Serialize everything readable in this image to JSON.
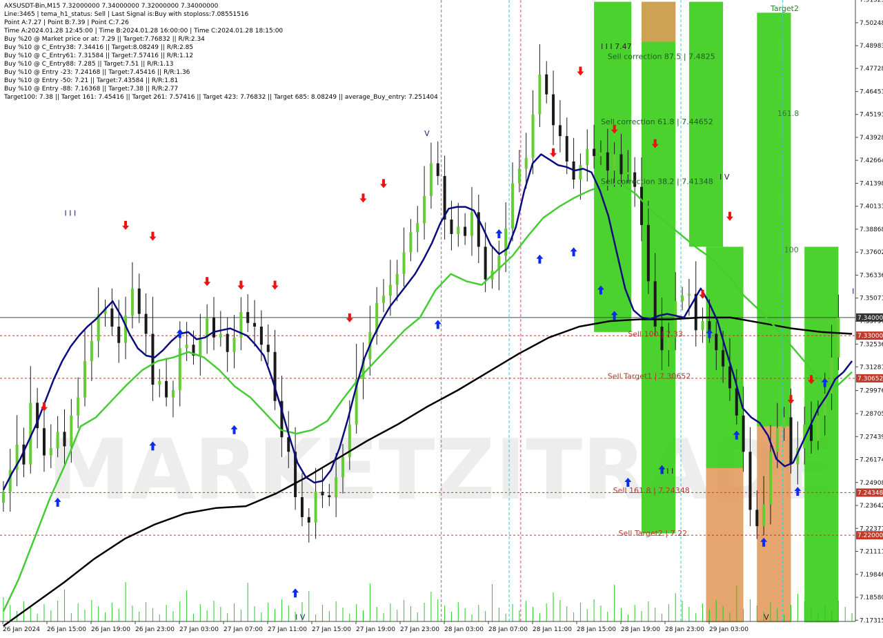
{
  "header": {
    "lines": [
      "AXSUSDT-Bin,M15  7.32000000 7.34000000 7.32000000 7.34000000",
      "Line:3465  |  tema_h1_status: Sell  |  Last Signal is:Buy with stoploss:7.08551516",
      "Point A:7.27  |  Point B:7.39  |  Point C:7.26",
      "Time A:2024.01.28 12:45:00  |  Time B:2024.01.28 16:00:00  |  Time C:2024.01.28 18:15:00",
      "Buy %20 @ Market price or at: 7.29  ||  Target:7.76832  ||  R/R:2.34",
      "Buy %10 @ C_Entry38: 7.34416  ||  Target:8.08249  ||  R/R:2.85",
      "Buy %10 @ C_Entry61: 7.31584  ||  Target:7.57416  ||  R/R:1.12",
      "Buy %10 @ C_Entry88: 7.285  ||  Target:7.51  ||  R/R:1.13",
      "Buy %10 @ Entry -23: 7.24168  ||  Target:7.45416  ||  R/R:1.36",
      "Buy %10 @ Entry -50: 7.21  ||  Target:7.43584  ||  R/R:1.81",
      "Buy %10 @ Entry -88: 7.16368  ||  Target:7.38  ||  R/R:2.77",
      "Target100: 7.38  ||  Target 161: 7.45416  ||  Target 261: 7.57416  ||  Target 423: 7.76832  ||  Target 685: 8.08249  ||  average_Buy_entry: 7.251404"
    ]
  },
  "chart_data": {
    "type": "candlestick",
    "symbol": "AXSUSDT-Bin",
    "timeframe": "M15",
    "ylim": [
      7.1725,
      7.515
    ],
    "y_ticks": [
      "7.51523",
      "7.50248",
      "7.48983",
      "7.47728",
      "7.46453",
      "7.45193",
      "7.43928",
      "7.42664",
      "7.41398",
      "7.40133",
      "7.38868",
      "7.37602",
      "7.36336",
      "7.35071",
      "7.33797",
      "7.32536",
      "7.31281",
      "7.29976",
      "7.28705",
      "7.27439",
      "7.26174",
      "7.24908",
      "7.23642",
      "7.22377",
      "7.21111",
      "7.19846",
      "7.18580",
      "7.17315"
    ],
    "x_ticks": [
      "26 Jan 2024",
      "26 Jan 15:00",
      "26 Jan 19:00",
      "26 Jan 23:00",
      "27 Jan 03:00",
      "27 Jan 07:00",
      "27 Jan 11:00",
      "27 Jan 15:00",
      "27 Jan 19:00",
      "27 Jan 23:00",
      "28 Jan 03:00",
      "28 Jan 07:00",
      "28 Jan 11:00",
      "28 Jan 15:00",
      "28 Jan 19:00",
      "28 Jan 23:00",
      "29 Jan 03:00"
    ],
    "price_labels": [
      {
        "value": 7.34,
        "text": "7.34000",
        "color": "#333333"
      },
      {
        "value": 7.33,
        "text": "7.33000",
        "color": "#c0392b"
      },
      {
        "value": 7.3065,
        "text": "7.30652",
        "color": "#c0392b"
      },
      {
        "value": 7.2435,
        "text": "7.24348",
        "color": "#c0392b"
      },
      {
        "value": 7.22,
        "text": "7.22000",
        "color": "#c0392b"
      }
    ],
    "levels": [
      {
        "value": 7.34,
        "color": "#34495e",
        "style": "solid"
      },
      {
        "value": 7.33,
        "color": "#c0392b",
        "style": "dashed"
      },
      {
        "value": 7.3065,
        "color": "#c0392b",
        "style": "dashed"
      },
      {
        "value": 7.2435,
        "color": "#c0392b",
        "style": "dashed"
      },
      {
        "value": 7.22,
        "color": "#c0392b",
        "style": "dashed"
      }
    ],
    "annotations": [
      {
        "text": "I I I 7.47",
        "x": 88,
        "y": 7.488,
        "color": "#222222"
      },
      {
        "text": "Sell correction 87.5 | 7.4825",
        "x": 89,
        "y": 7.4825,
        "color": "#1b5e20"
      },
      {
        "text": "Sell correction 61.8 | 7.44652",
        "x": 88,
        "y": 7.4465,
        "color": "#1b5e20"
      },
      {
        "text": "Sell correction 38.2 | 7.41348",
        "x": 88,
        "y": 7.4135,
        "color": "#1b5e20"
      },
      {
        "text": "Sell 100 | 7.33",
        "x": 92,
        "y": 7.3295,
        "color": "#b03a2e"
      },
      {
        "text": "Sell Target1 | 7.30652",
        "x": 89,
        "y": 7.3062,
        "color": "#b03a2e"
      },
      {
        "text": "Sell 161.8 | 7.24348",
        "x": 89.8,
        "y": 7.2432,
        "color": "#b03a2e"
      },
      {
        "text": "Sell Target2 | 7.22",
        "x": 90.6,
        "y": 7.2197,
        "color": "#b03a2e"
      },
      {
        "text": "Target2",
        "x": 113,
        "y": 7.509,
        "color": "#2e7d32"
      },
      {
        "text": "161.8",
        "x": 114,
        "y": 7.451,
        "color": "#2e7d32"
      },
      {
        "text": "100",
        "x": 115,
        "y": 7.376,
        "color": "#2e7d32"
      },
      {
        "text": "I I I",
        "x": 9,
        "y": 7.396,
        "color": "#1a237e"
      },
      {
        "text": "V",
        "x": 62,
        "y": 7.44,
        "color": "#1a237e"
      },
      {
        "text": "I V",
        "x": 105.5,
        "y": 7.416,
        "color": "#222222"
      },
      {
        "text": "I I I",
        "x": 97,
        "y": 7.254,
        "color": "#222222"
      },
      {
        "text": "I",
        "x": 125,
        "y": 7.353,
        "color": "#1a237e"
      },
      {
        "text": "I V",
        "x": 43,
        "y": 7.1735,
        "color": "#1a237e"
      },
      {
        "text": "V",
        "x": 112,
        "y": 7.1735,
        "color": "#222222"
      }
    ],
    "watermark": "MARKETZITRADE",
    "zones": [
      {
        "x0": 87,
        "x1": 92.5,
        "y0": 7.332,
        "y1": 7.514,
        "color": "#33cc11"
      },
      {
        "x0": 94,
        "x1": 99,
        "y0": 7.221,
        "y1": 7.514,
        "color": "#33cc11"
      },
      {
        "x0": 94,
        "x1": 99,
        "y0": 7.492,
        "y1": 7.514,
        "color": "#e09a5a"
      },
      {
        "x0": 101,
        "x1": 106,
        "y0": 7.379,
        "y1": 7.514,
        "color": "#33cc11"
      },
      {
        "x0": 103.5,
        "x1": 109,
        "y0": 7.257,
        "y1": 7.379,
        "color": "#33cc11"
      },
      {
        "x0": 103.5,
        "x1": 109,
        "y0": 7.172,
        "y1": 7.257,
        "color": "#e09a5a"
      },
      {
        "x0": 111,
        "x1": 116,
        "y0": 7.28,
        "y1": 7.508,
        "color": "#33cc11"
      },
      {
        "x0": 111,
        "x1": 116,
        "y0": 7.172,
        "y1": 7.28,
        "color": "#e09a5a"
      },
      {
        "x0": 118,
        "x1": 123,
        "y0": 7.172,
        "y1": 7.379,
        "color": "#33cc11"
      }
    ],
    "vlines": [
      {
        "x": 64.5,
        "color": "#e0408a",
        "style": "dashed"
      },
      {
        "x": 74.5,
        "color": "#33c9d6",
        "style": "dashed"
      },
      {
        "x": 76.2,
        "color": "#e0408a",
        "style": "dashed"
      },
      {
        "x": 99.8,
        "color": "#33c9d6",
        "style": "dashed"
      },
      {
        "x": 114.8,
        "color": "#33c9d6",
        "style": "dashed"
      }
    ],
    "close": [
      7.244,
      7.256,
      7.27,
      7.259,
      7.293,
      7.279,
      7.264,
      7.268,
      7.277,
      7.269,
      7.286,
      7.296,
      7.316,
      7.327,
      7.342,
      7.345,
      7.335,
      7.326,
      7.341,
      7.356,
      7.342,
      7.331,
      7.303,
      7.305,
      7.296,
      7.3,
      7.323,
      7.325,
      7.319,
      7.329,
      7.34,
      7.329,
      7.331,
      7.321,
      7.329,
      7.343,
      7.337,
      7.335,
      7.325,
      7.321,
      7.294,
      7.274,
      7.266,
      7.241,
      7.23,
      7.227,
      7.244,
      7.242,
      7.241,
      7.252,
      7.263,
      7.281,
      7.306,
      7.317,
      7.332,
      7.348,
      7.352,
      7.358,
      7.364,
      7.376,
      7.387,
      7.392,
      7.407,
      7.425,
      7.418,
      7.394,
      7.386,
      7.39,
      7.385,
      7.398,
      7.379,
      7.361,
      7.366,
      7.374,
      7.389,
      7.414,
      7.422,
      7.428,
      7.452,
      7.474,
      7.463,
      7.446,
      7.44,
      7.426,
      7.416,
      7.424,
      7.433,
      7.429,
      7.431,
      7.421,
      7.43,
      7.419,
      7.42,
      7.412,
      7.391,
      7.36,
      7.335,
      7.322,
      7.329,
      7.349,
      7.352,
      7.353,
      7.333,
      7.338,
      7.331,
      7.322,
      7.313,
      7.301,
      7.286,
      7.266,
      7.234,
      7.225,
      7.237,
      7.266,
      7.279,
      7.285,
      7.259,
      7.268,
      7.281,
      7.272,
      7.286,
      7.298,
      7.318,
      7.34
    ],
    "ma_navy": [
      7.245,
      7.254,
      7.262,
      7.272,
      7.282,
      7.294,
      7.306,
      7.316,
      7.324,
      7.33,
      7.335,
      7.339,
      7.344,
      7.349,
      7.341,
      7.331,
      7.323,
      7.319,
      7.318,
      7.322,
      7.327,
      7.331,
      7.332,
      7.328,
      7.329,
      7.332,
      7.333,
      7.334,
      7.332,
      7.33,
      7.325,
      7.319,
      7.306,
      7.291,
      7.275,
      7.26,
      7.252,
      7.249,
      7.25,
      7.256,
      7.268,
      7.284,
      7.302,
      7.318,
      7.329,
      7.338,
      7.346,
      7.352,
      7.358,
      7.364,
      7.372,
      7.381,
      7.392,
      7.4,
      7.401,
      7.401,
      7.399,
      7.39,
      7.38,
      7.375,
      7.378,
      7.39,
      7.41,
      7.425,
      7.43,
      7.427,
      7.424,
      7.423,
      7.421,
      7.422,
      7.42,
      7.41,
      7.396,
      7.376,
      7.356,
      7.344,
      7.34,
      7.339,
      7.341,
      7.342,
      7.341,
      7.34,
      7.348,
      7.356,
      7.348,
      7.338,
      7.322,
      7.307,
      7.29,
      7.285,
      7.282,
      7.275,
      7.262,
      7.258,
      7.26,
      7.27,
      7.28,
      7.29,
      7.297,
      7.306,
      7.31,
      7.316
    ],
    "ma_green": [
      7.178,
      7.196,
      7.218,
      7.24,
      7.259,
      7.28,
      7.285,
      7.294,
      7.303,
      7.311,
      7.316,
      7.318,
      7.321,
      7.318,
      7.311,
      7.302,
      7.296,
      7.287,
      7.278,
      7.276,
      7.278,
      7.283,
      7.295,
      7.306,
      7.315,
      7.324,
      7.333,
      7.34,
      7.355,
      7.364,
      7.36,
      7.358,
      7.366,
      7.374,
      7.385,
      7.395,
      7.401,
      7.406,
      7.41,
      7.413,
      7.414,
      7.408,
      7.399,
      7.392,
      7.385,
      7.378,
      7.372,
      7.363,
      7.352,
      7.344,
      7.335,
      7.325,
      7.315,
      7.305,
      7.302,
      7.31
    ],
    "ma_black": [
      7.17,
      7.182,
      7.194,
      7.207,
      7.218,
      7.226,
      7.232,
      7.235,
      7.236,
      7.243,
      7.252,
      7.262,
      7.272,
      7.281,
      7.291,
      7.3,
      7.31,
      7.32,
      7.329,
      7.335,
      7.338,
      7.339,
      7.339,
      7.34,
      7.34,
      7.337,
      7.334,
      7.332,
      7.331
    ],
    "arrows_up": [
      [
        8,
        7.238
      ],
      [
        22,
        7.269
      ],
      [
        26,
        7.331
      ],
      [
        34,
        7.278
      ],
      [
        43,
        7.188
      ],
      [
        64,
        7.336
      ],
      [
        73,
        7.386
      ],
      [
        79,
        7.372
      ],
      [
        84,
        7.376
      ],
      [
        88,
        7.355
      ],
      [
        90,
        7.341
      ],
      [
        92,
        7.249
      ],
      [
        97,
        7.256
      ],
      [
        104,
        7.331
      ],
      [
        108,
        7.275
      ],
      [
        112,
        7.216
      ],
      [
        117,
        7.244
      ],
      [
        121,
        7.304
      ]
    ],
    "arrows_down": [
      [
        6,
        7.291
      ],
      [
        18,
        7.391
      ],
      [
        22,
        7.385
      ],
      [
        30,
        7.36
      ],
      [
        35,
        7.358
      ],
      [
        40,
        7.358
      ],
      [
        51,
        7.34
      ],
      [
        53,
        7.406
      ],
      [
        56,
        7.414
      ],
      [
        81,
        7.431
      ],
      [
        85,
        7.476
      ],
      [
        90,
        7.444
      ],
      [
        96,
        7.436
      ],
      [
        103,
        7.353
      ],
      [
        107,
        7.396
      ],
      [
        116,
        7.295
      ],
      [
        119,
        7.306
      ]
    ]
  }
}
